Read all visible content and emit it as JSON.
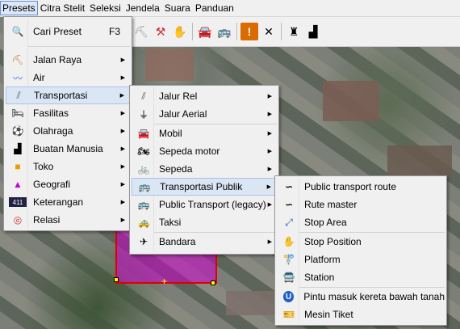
{
  "menubar": [
    "Presets",
    "Citra Stelit",
    "Seleksi",
    "Jendela",
    "Suara",
    "Panduan"
  ],
  "presets_menu": {
    "search": {
      "label": "Cari Preset",
      "shortcut": "F3"
    },
    "items": [
      {
        "label": "Jalan Raya",
        "icon": "road-icon"
      },
      {
        "label": "Air",
        "icon": "water-icon"
      },
      {
        "label": "Transportasi",
        "icon": "rail-track-icon"
      },
      {
        "label": "Fasilitas",
        "icon": "bed-icon"
      },
      {
        "label": "Olahraga",
        "icon": "ball-icon"
      },
      {
        "label": "Buatan Manusia",
        "icon": "factory-icon"
      },
      {
        "label": "Toko",
        "icon": "shopping-bag-icon"
      },
      {
        "label": "Geografi",
        "icon": "triangle-icon"
      },
      {
        "label": "Keterangan",
        "icon": "keterangan-icon"
      },
      {
        "label": "Relasi",
        "icon": "relation-icon"
      }
    ]
  },
  "transport_menu": {
    "items": [
      {
        "label": "Jalur Rel",
        "icon": "rail-icon"
      },
      {
        "label": "Jalur Aerial",
        "icon": "aerialway-icon"
      },
      {
        "label": "Mobil",
        "icon": "car-icon"
      },
      {
        "label": "Sepeda motor",
        "icon": "motorcycle-icon"
      },
      {
        "label": "Sepeda",
        "icon": "bicycle-icon"
      },
      {
        "label": "Transportasi Publik",
        "icon": "bus-icon"
      },
      {
        "label": "Public Transport (legacy)",
        "icon": "bus-legacy-icon"
      },
      {
        "label": "Taksi",
        "icon": "taxi-icon"
      },
      {
        "label": "Bandara",
        "icon": "airplane-icon"
      }
    ]
  },
  "public_menu": {
    "items": [
      {
        "label": "Public transport route",
        "icon": "route-icon"
      },
      {
        "label": "Rute master",
        "icon": "route-master-icon"
      },
      {
        "label": "Stop Area",
        "icon": "stop-area-icon"
      },
      {
        "label": "Stop Position",
        "icon": "hand-icon"
      },
      {
        "label": "Platform",
        "icon": "platform-icon"
      },
      {
        "label": "Station",
        "icon": "station-icon"
      },
      {
        "label": "Pintu masuk kereta bawah tanah",
        "icon": "subway-entrance-icon"
      },
      {
        "label": "Mesin Tiket",
        "icon": "ticket-machine-icon"
      }
    ]
  }
}
